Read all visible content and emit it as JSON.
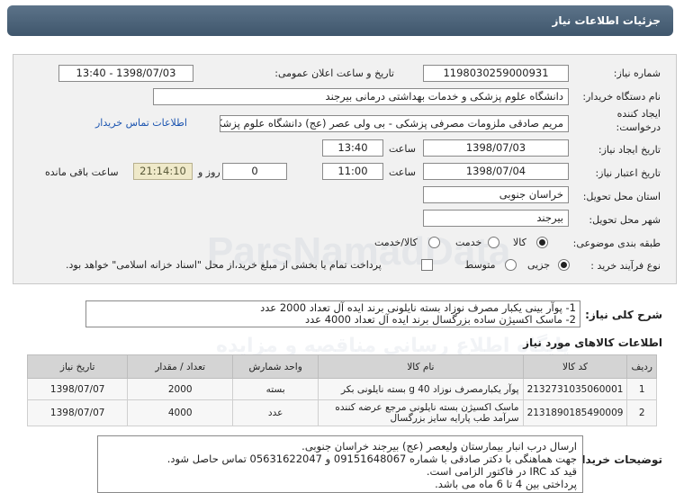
{
  "title": "جزئیات اطلاعات نیاز",
  "watermark": {
    "line1": "ParsNamadData",
    "line2": "پایگاه اطلاع رسانی مناقصه و مزایده"
  },
  "fields": {
    "need_number_label": "شماره نیاز:",
    "need_number": "1198030259000931",
    "announce_label": "تاریخ و ساعت اعلان عمومی:",
    "announce_value": "1398/07/03 - 13:40",
    "buyer_label": "نام دستگاه خریدار:",
    "buyer": "دانشگاه علوم پزشکی و خدمات بهداشتی درمانی بیرجند",
    "creator_label_1": "ایجاد کننده",
    "creator_label_2": "درخواست:",
    "creator": "مریم صادقی ملزومات مصرفی پزشکی - بی ولی عصر (عج) دانشگاه علوم پزشکی",
    "contact_link": "اطلاعات تماس خریدار",
    "created_date_label": "تاریخ ایجاد نیاز:",
    "created_date": "1398/07/03",
    "time_label": "ساعت",
    "created_time": "13:40",
    "valid_date_label": "تاریخ اعتبار نیاز:",
    "valid_date": "1398/07/04",
    "valid_time": "11:00",
    "days_value": "0",
    "days_label": "روز و",
    "remaining_value": "21:14:10",
    "remaining_label": "ساعت باقی مانده",
    "province_label": "استان محل تحویل:",
    "province": "خراسان جنوبی",
    "city_label": "شهر محل تحویل:",
    "city": "بیرجند",
    "category_label": "طبقه بندی موضوعی:",
    "category_options": [
      "کالا",
      "خدمت",
      "کالا/خدمت"
    ],
    "process_label": "نوع فرآیند خرید :",
    "process_options": [
      "جزیی",
      "متوسط"
    ],
    "payment_note": "پرداخت تمام یا بخشی از مبلغ خرید،از محل \"اسناد خزانه اسلامی\" خواهد بود."
  },
  "description": {
    "label": "شرح کلی نیاز:",
    "line1": "1- پوآر بینی یکبار مصرف نوزاد بسته نایلونی برند ایده آل تعداد 2000 عدد",
    "line2": "2- ماسک اکسیژن ساده بزرگسال برند ایده آل تعداد 4000 عدد"
  },
  "goods": {
    "section_title": "اطلاعات کالاهای مورد نیاز",
    "headers": [
      "ردیف",
      "کد کالا",
      "نام کالا",
      "واحد شمارش",
      "تعداد / مقدار",
      "تاریخ نیاز"
    ],
    "rows": [
      {
        "idx": "1",
        "code": "2132731035060001",
        "name": "پوآر یکبارمصرف نوزاد 40 g بسته نایلونی بکر",
        "unit": "بسته",
        "qty": "2000",
        "date": "1398/07/07"
      },
      {
        "idx": "2",
        "code": "2131890185490009",
        "name": "ماسک اکسیژن بسته نایلونی مرجع عرضه کننده سرآمد طب پارایه سایز بزرگسال",
        "unit": "عدد",
        "qty": "4000",
        "date": "1398/07/07"
      }
    ]
  },
  "notes": {
    "label": "توضیحات خریدار:",
    "lines": [
      "ارسال درب انبار بیمارستان ولیعصر (عج) بیرجند خراسان جنوبی.",
      "جهت هماهنگی با دکتر صادقی با شماره 09151648067 و 05631622047 تماس حاصل شود.",
      "قید کد IRC در فاکتور الزامی است.",
      "پرداختی بین 4 تا 6 ماه می باشد."
    ]
  }
}
